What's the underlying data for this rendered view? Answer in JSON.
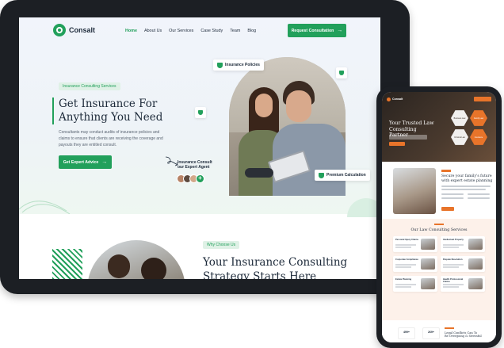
{
  "tablet": {
    "brand": "Consalt",
    "nav": [
      "Home",
      "About Us",
      "Our Services",
      "Case Study",
      "Team",
      "Blog"
    ],
    "cta": "Request Consultation",
    "hero": {
      "tag": "Insurance Consulting Services",
      "title": "Get Insurance For\nAnything You Need",
      "description": "Consultants may conduct audits of insurance policies and claims to ensure that clients are receiving the coverage and payouts they are entitled consult.",
      "button": "Get Expert Advice",
      "agent_label": "Insurance Consult\nour Expert Agent",
      "chip_policies": "Insurance Policies",
      "chip_premium": "Premium Calculation",
      "avatar_plus": "+"
    },
    "why": {
      "tag": "Why Choose Us",
      "title": "Your Insurance Consulting\nStrategy Starts Here"
    }
  },
  "phone": {
    "hero_tag": "",
    "hero_title": "Your Trusted Law\nConsulting Partner",
    "hexes": [
      "Business Law",
      "Family Law",
      "Criminal Law",
      "Insurance"
    ],
    "about_title": "Secure your family's future\nwith expert estate planning",
    "services_title": "Our Law Consulting Services",
    "services": [
      "Personal Injury Claims",
      "Intellectual Property",
      "Corporate Compliance",
      "Dispute Resolution",
      "Estate Planning",
      "Health Professional Claims"
    ],
    "stats": [
      "499+",
      "269+"
    ],
    "bottom_title": "Legal Conflicts Can To\nBe Overgoing & Stressful"
  },
  "colors": {
    "primary_green": "#22a05b",
    "accent_orange": "#e8742a",
    "text_dark": "#1d2a3a",
    "device_frame": "#1c1f24"
  },
  "icons": [
    "shield-icon",
    "arrow-right-icon",
    "scribble-arrow-icon",
    "logo-icon",
    "plus-icon"
  ]
}
